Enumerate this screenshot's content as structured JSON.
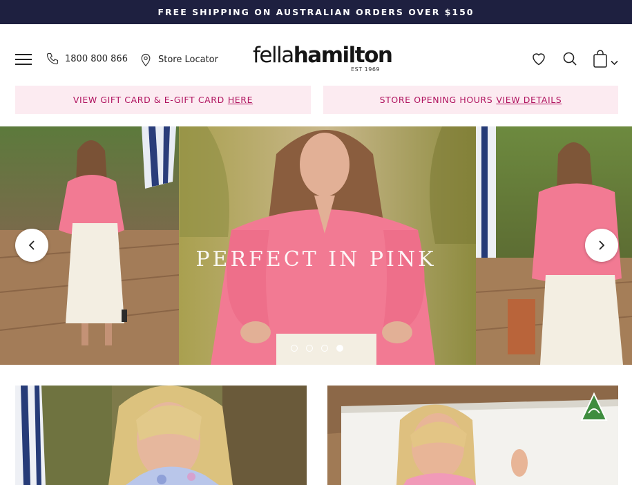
{
  "announcement": {
    "text": "FREE SHIPPING ON AUSTRALIAN ORDERS OVER $150"
  },
  "header": {
    "phone": "1800 800 866",
    "store_locator": "Store Locator",
    "logo": {
      "text_light": "fella",
      "text_bold": "hamilton",
      "est": "EST 1969"
    }
  },
  "promos": [
    {
      "text": "VIEW GIFT CARD & E-GIFT CARD",
      "link": "HERE"
    },
    {
      "text": "STORE OPENING HOURS",
      "link": "VIEW DETAILS"
    }
  ],
  "hero": {
    "title": "PERFECT IN PINK",
    "slide_count": 4,
    "active_slide": 4
  },
  "colors": {
    "topbar": "#1e2040",
    "promo_bg": "#fcebf1",
    "promo_text": "#b0135f",
    "blouse_pink": "#f27a93"
  },
  "icons": [
    "menu-icon",
    "phone-icon",
    "location-pin-icon",
    "heart-icon",
    "search-icon",
    "bag-icon",
    "chevron-down-icon",
    "chevron-left-icon",
    "chevron-right-icon",
    "australian-made-icon"
  ]
}
